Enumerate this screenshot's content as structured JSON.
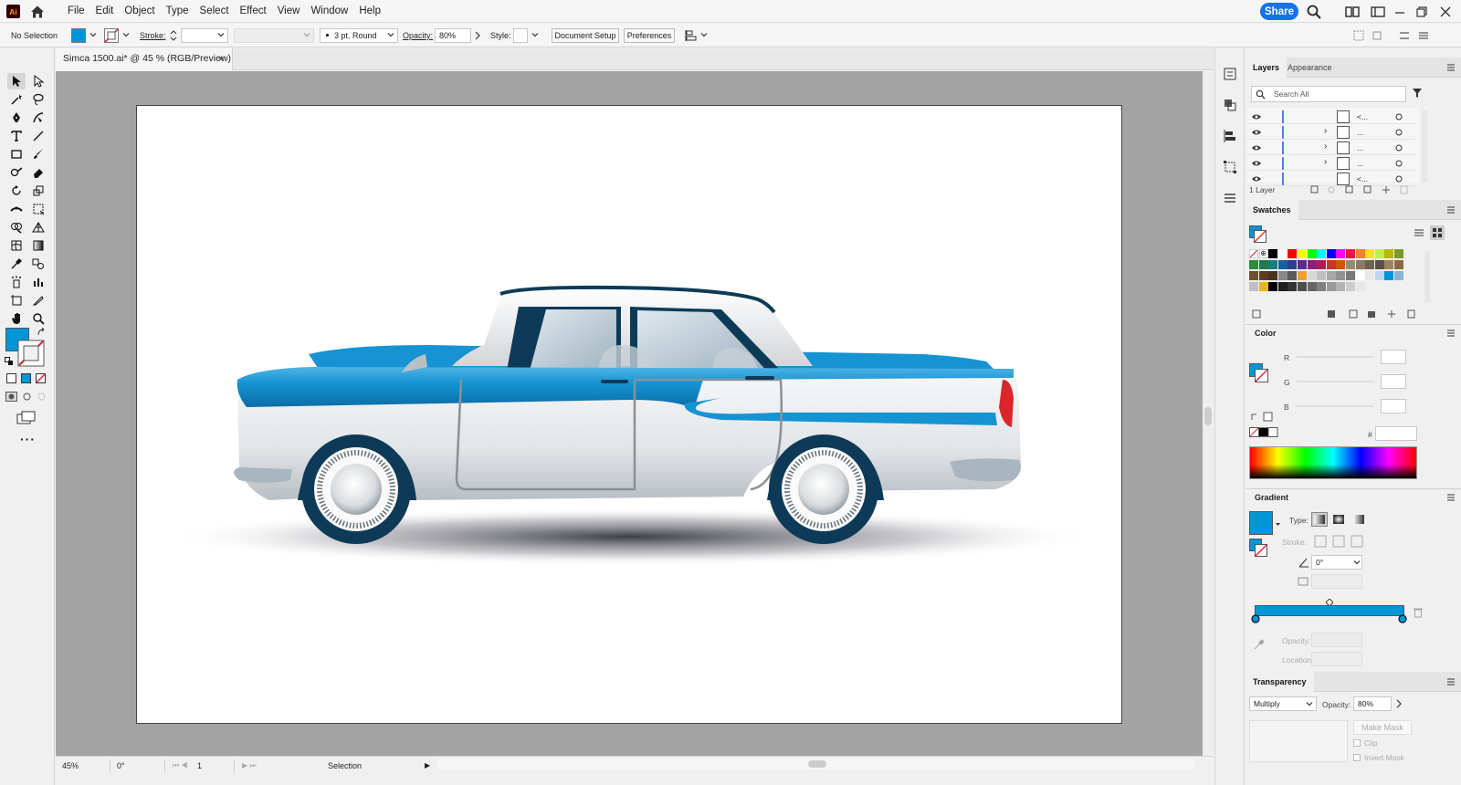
{
  "app": {
    "logo_text": "Ai",
    "menu": [
      "File",
      "Edit",
      "Object",
      "Type",
      "Select",
      "Effect",
      "View",
      "Window",
      "Help"
    ],
    "share_label": "Share"
  },
  "control_bar": {
    "selection_label": "No Selection",
    "stroke_label": "Stroke:",
    "brush_label": "3 pt. Round",
    "opacity_label": "Opacity:",
    "opacity_value": "80%",
    "style_label": "Style:",
    "document_setup_label": "Document Setup",
    "preferences_label": "Preferences"
  },
  "document": {
    "tab_title": "Simca 1500.ai* @ 45 % (RGB/Preview)",
    "close_glyph": "×"
  },
  "status": {
    "zoom": "45%",
    "rotation": "0°",
    "artboard": "1",
    "tool": "Selection"
  },
  "layers_panel": {
    "tabs": [
      "Layers",
      "Appearance"
    ],
    "search_placeholder": "Search All",
    "rows": [
      {
        "expand": "",
        "name": "<..."
      },
      {
        "expand": "›",
        "name": "..."
      },
      {
        "expand": "›",
        "name": "..."
      },
      {
        "expand": "›",
        "name": "..."
      },
      {
        "expand": "",
        "name": "<..."
      }
    ],
    "footer": "1 Layer"
  },
  "swatches_panel": {
    "title": "Swatches",
    "colors": [
      "#000000",
      "#ffffff",
      "#ff0000",
      "#ffff00",
      "#00ff00",
      "#00ffff",
      "#0000ff",
      "#ff00ff",
      "#e6194b",
      "#f58231",
      "#ffe119",
      "#bfef45",
      "#b8b800",
      "#7a9a2a",
      "#2d8c3c",
      "#1f7a4d",
      "#177e7e",
      "#1a5fa3",
      "#2c3e8f",
      "#5b2c8f",
      "#8c1f7a",
      "#a3225a",
      "#c0392b",
      "#d35400",
      "#9c8a6e",
      "#8a7a60",
      "#6e6352",
      "#5a5046",
      "#a0825a",
      "#8a6a3e",
      "#6e5030",
      "#5a3e22",
      "#4a3222",
      "#888888",
      "#5c5c5c",
      "#f0a030",
      "#d8d8d8",
      "#c0c0c0",
      "#a8a8a8",
      "#909090",
      "#787878",
      "#ffffff",
      "#e8e8e8",
      "#bcd8f0",
      "#0095d9",
      "#8ab4d8",
      "#c0c0c0",
      "#e8b800",
      "#000000",
      "#1e1e1e",
      "#333333",
      "#4d4d4d",
      "#666666",
      "#808080",
      "#999999",
      "#b3b3b3",
      "#cccccc",
      "#e6e6e6"
    ]
  },
  "color_panel": {
    "title": "Color",
    "channels": [
      "R",
      "G",
      "B"
    ],
    "hex_prefix": "#"
  },
  "gradient_panel": {
    "title": "Gradient",
    "type_label": "Type:",
    "stroke_label": "Stroke:",
    "angle_value": "0°",
    "opacity_label": "Opacity:",
    "location_label": "Location:",
    "gradient_color": "#0095d9"
  },
  "transparency_panel": {
    "title": "Transparency",
    "blend_mode": "Multiply",
    "opacity_label": "Opacity:",
    "opacity_value": "80%",
    "make_mask_label": "Make Mask",
    "clip_label": "Clip",
    "invert_mask_label": "Invert Mask"
  },
  "colors": {
    "fill": "#0095d9",
    "car_blue": "#1593d2",
    "car_white": "#e8eaec",
    "accent_red": "#d9262b"
  }
}
